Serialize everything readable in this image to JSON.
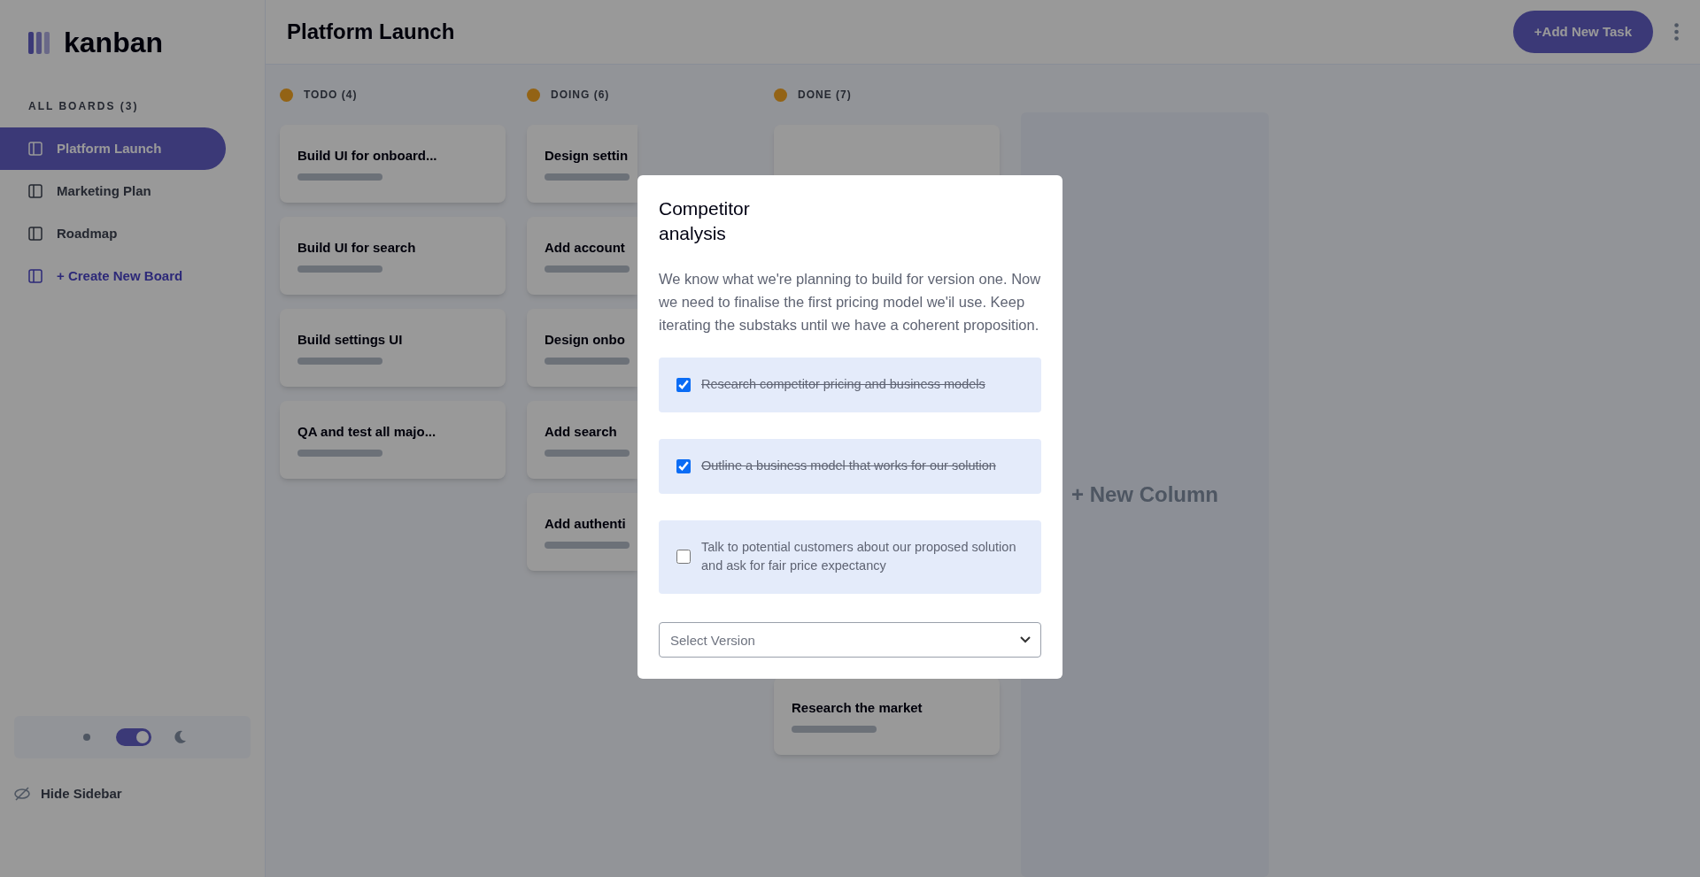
{
  "sidebar": {
    "logo": "kanban",
    "heading": "ALL BOARDS (3)",
    "boards": [
      {
        "name": "Platform Launch",
        "selected": true
      },
      {
        "name": "Marketing Plan",
        "selected": false
      },
      {
        "name": "Roadmap",
        "selected": false
      }
    ],
    "create_board": "+ Create New Board",
    "theme_toggle": {
      "on": true
    },
    "hide_sidebar": "Hide Sidebar"
  },
  "header": {
    "board_title": "Platform Launch",
    "add_task": "+Add New Task"
  },
  "columns": [
    {
      "name": "TODO (4)",
      "cards": [
        {
          "title": "Build UI for onboard..."
        },
        {
          "title": "Build UI for search"
        },
        {
          "title": "Build settings UI"
        },
        {
          "title": "QA and test all majo..."
        }
      ]
    },
    {
      "name": "DOING (6)",
      "cards": [
        {
          "title": "Design settin"
        },
        {
          "title": "Add account"
        },
        {
          "title": "Design onbo"
        },
        {
          "title": "Add search"
        },
        {
          "title": "Add authenti"
        }
      ]
    },
    {
      "name": "DONE (7)",
      "cards": [
        {
          "title": "Research the market"
        }
      ]
    }
  ],
  "new_column": "+ New Column",
  "modal": {
    "title": "Competitor analysis",
    "description": "We know what we're planning to build for version one. Now we need to finalise the first pricing model we'il use. Keep iterating the substaks until we have a coherent proposition.",
    "subtasks": [
      {
        "label": "Research competitor pricing and business models",
        "checked": true
      },
      {
        "label": "Outline a business model that works for our solution",
        "checked": true
      },
      {
        "label": "Talk to potential customers about our proposed solution and ask for fair price expectancy",
        "checked": false
      }
    ],
    "status": {
      "placeholder": "Select Version"
    }
  }
}
